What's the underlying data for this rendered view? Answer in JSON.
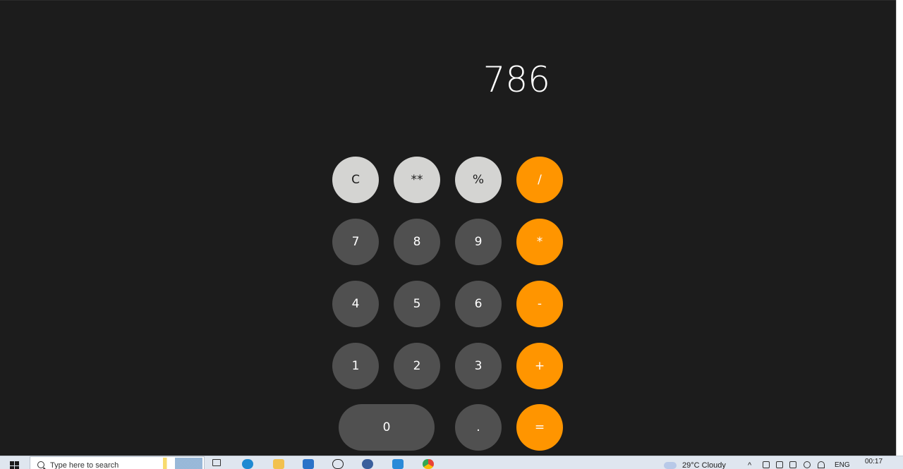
{
  "calculator": {
    "display_value": "786",
    "keys": {
      "clear": "C",
      "power": "**",
      "percent": "%",
      "divide": "/",
      "seven": "7",
      "eight": "8",
      "nine": "9",
      "multiply": "*",
      "four": "4",
      "five": "5",
      "six": "6",
      "subtract": "-",
      "one": "1",
      "two": "2",
      "three": "3",
      "add": "+",
      "zero": "0",
      "decimal": ".",
      "equals": "="
    },
    "colors": {
      "background": "#1c1c1c",
      "function_key": "#d4d4d2",
      "number_key": "#505050",
      "operator_key": "#ff9500"
    }
  },
  "taskbar": {
    "search_placeholder": "Type here to search",
    "weather": "29°C  Cloudy",
    "language": "ENG",
    "time": "00:17",
    "pinned_icons": [
      "task-view-icon",
      "edge-icon",
      "file-explorer-icon",
      "mail-icon",
      "dell-icon",
      "photos-icon",
      "vscode-icon",
      "chrome-icon"
    ]
  }
}
